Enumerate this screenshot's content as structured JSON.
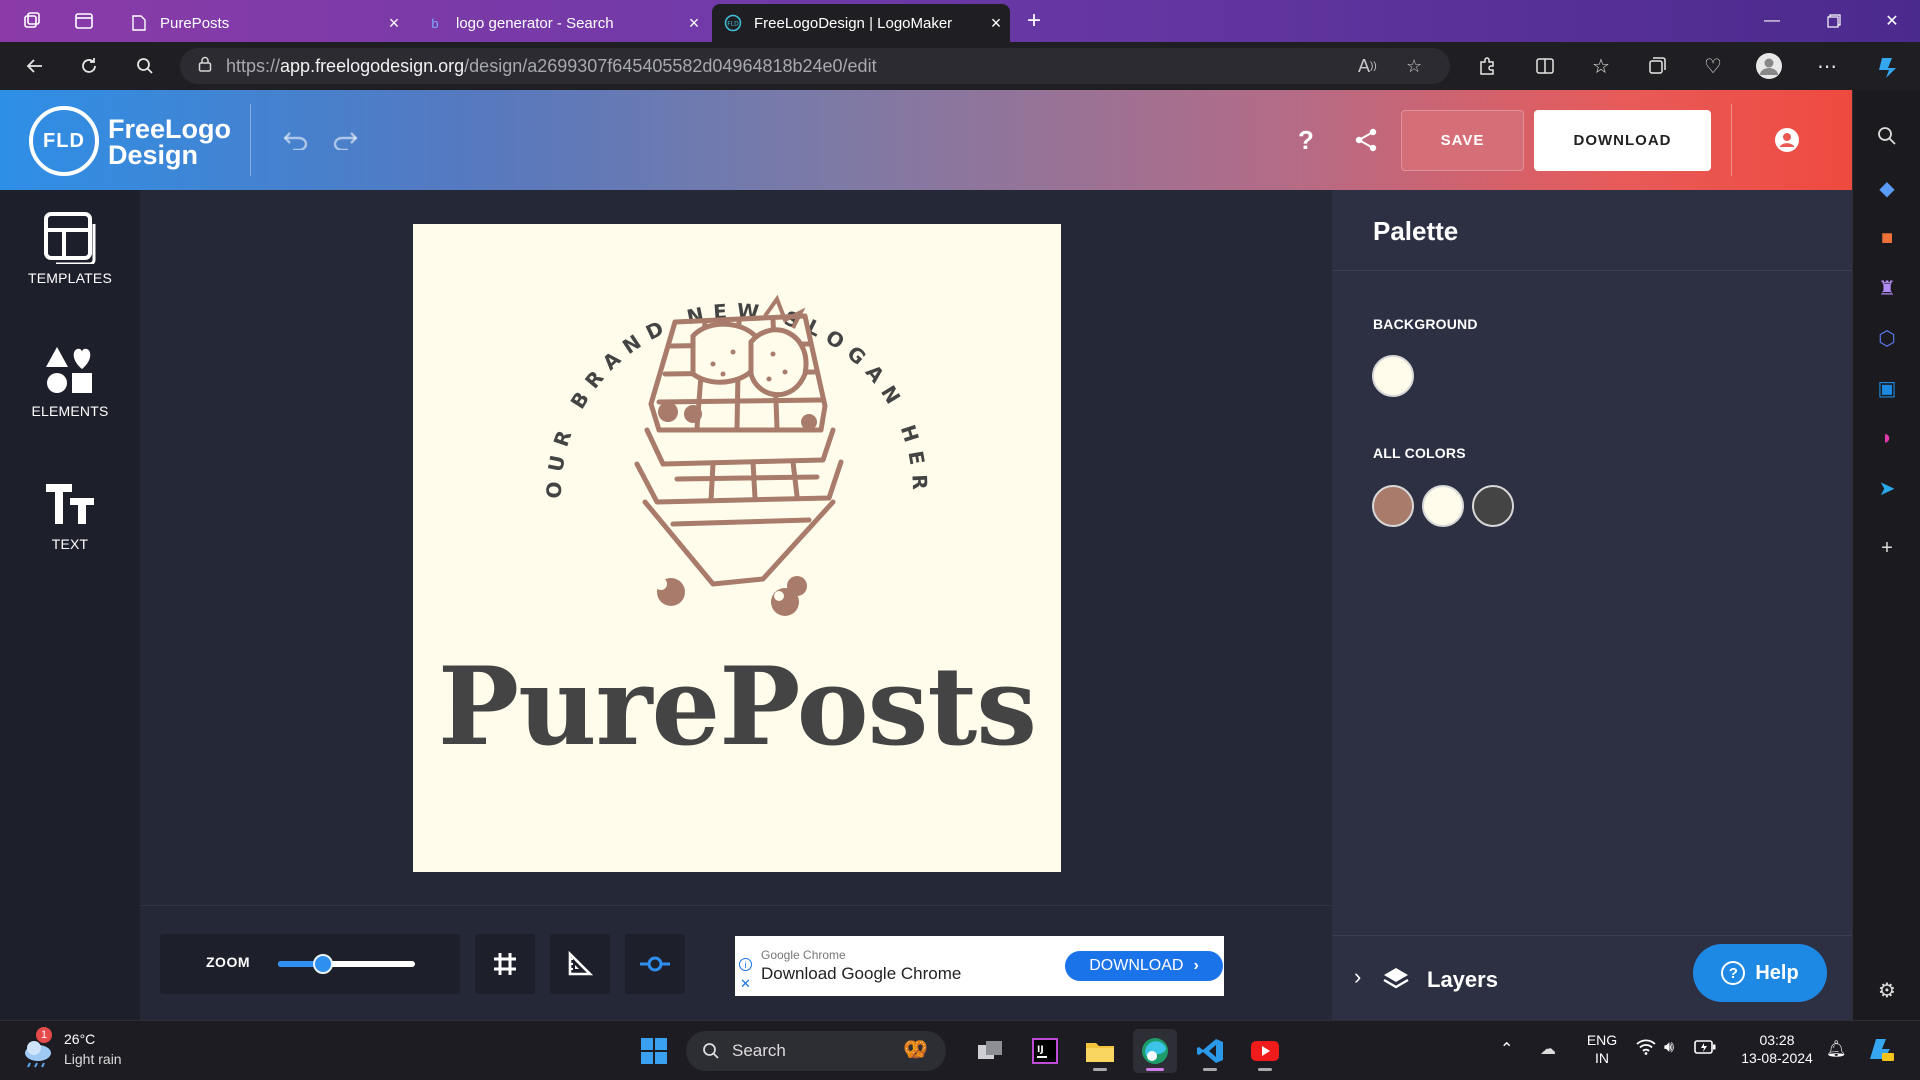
{
  "browser": {
    "tabs": [
      {
        "title": "PurePosts",
        "icon": "page-icon",
        "active": false
      },
      {
        "title": "logo generator - Search",
        "icon": "bing-icon",
        "active": false
      },
      {
        "title": "FreeLogoDesign | LogoMaker",
        "icon": "fld-icon",
        "active": true
      }
    ],
    "url_prefix": "https://",
    "url_host": "app.freelogodesign.org",
    "url_path": "/design/a2699307f645405582d04964818b24e0/edit"
  },
  "header": {
    "logo_mark": "FLD",
    "logo_line1": "FreeLogo",
    "logo_line2": "Design",
    "save_label": "SAVE",
    "download_label": "DOWNLOAD",
    "help_icon": "?"
  },
  "tools": [
    {
      "label": "TEMPLATES",
      "icon": "templates-icon"
    },
    {
      "label": "ELEMENTS",
      "icon": "shapes-icon"
    },
    {
      "label": "TEXT",
      "icon": "text-icon"
    }
  ],
  "canvas": {
    "brand_name": "PurePosts",
    "slogan": "YOUR BRAND NEW SLOGAN HERE",
    "background": "#fffcec",
    "illustration_color": "#a87b6a",
    "text_color": "#444444"
  },
  "zoom": {
    "label": "ZOOM",
    "level": 0.33
  },
  "ad": {
    "sub": "Google Chrome",
    "title": "Download Google Chrome",
    "button": "DOWNLOAD"
  },
  "palette": {
    "title": "Palette",
    "background_label": "BACKGROUND",
    "all_colors_label": "ALL COLORS",
    "background_color": "#fffcec",
    "colors": [
      "#a87b6a",
      "#fffcec",
      "#444444"
    ],
    "layers_label": "Layers",
    "help_label": "Help"
  },
  "taskbar": {
    "weather_temp": "26°C",
    "weather_desc": "Light rain",
    "weather_badge": "1",
    "search_placeholder": "Search",
    "lang1": "ENG",
    "lang2": "IN",
    "time": "03:28",
    "date": "13-08-2024"
  }
}
